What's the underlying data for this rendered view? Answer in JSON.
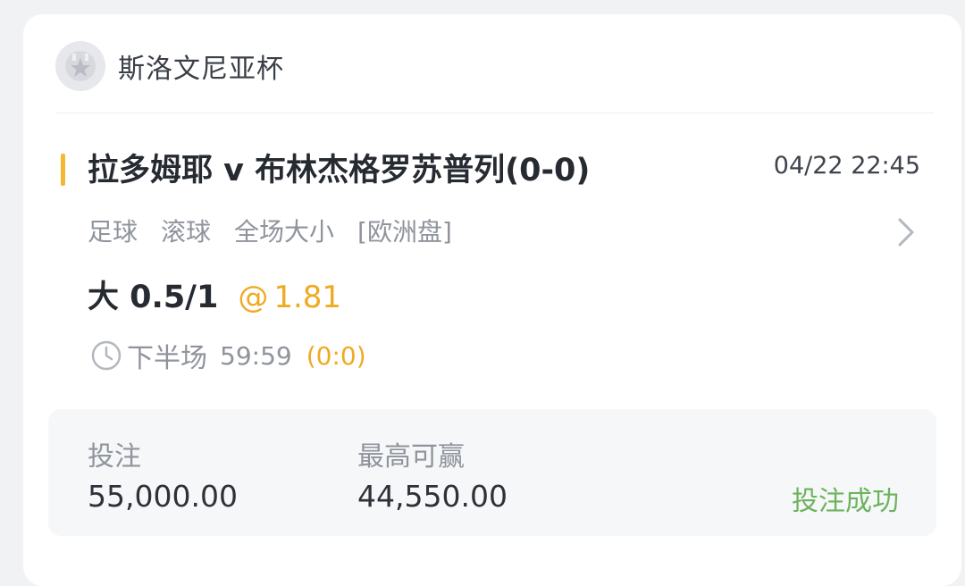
{
  "league": {
    "name": "斯洛文尼亚杯",
    "logo_icon": "league-badge-icon"
  },
  "match": {
    "title": "拉多姆耶 v 布林杰格罗苏普列(0-0)",
    "datetime": "04/22 22:45",
    "tags": [
      "足球",
      "滚球",
      "全场大小",
      "[欧洲盘]"
    ]
  },
  "selection": {
    "label": "大 0.5/1",
    "at_symbol": "@",
    "odds": "1.81"
  },
  "status": {
    "period": "下半场",
    "clock": "59:59",
    "score": "(0:0)"
  },
  "bet": {
    "stake_label": "投注",
    "stake_value": "55,000.00",
    "max_win_label": "最高可赢",
    "max_win_value": "44,550.00",
    "result": "投注成功"
  },
  "colors": {
    "accent": "#f5b631",
    "odds": "#efaa24",
    "success": "#6cb35c"
  }
}
